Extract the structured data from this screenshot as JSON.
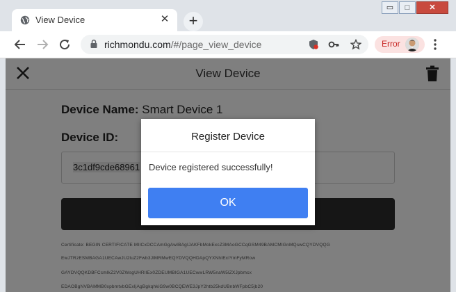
{
  "browser": {
    "tab_title": "View Device",
    "new_tab_label": "+",
    "window_controls": {
      "minimize": "▭",
      "maximize": "□",
      "close": "✕"
    },
    "url_host": "richmondu.com",
    "url_path": "/#/page_view_device",
    "error_label": "Error"
  },
  "page": {
    "title": "View Device",
    "device_name_label": "Device Name:",
    "device_name_value": "Smart Device 1",
    "device_id_label": "Device ID:",
    "device_id_value": "3c1df9cde68961",
    "cert_lines": [
      "Certificate:       BEGIN CERTIFICATE          MIICxDCCAmGgAwIBAgIJAKFbMokExcZ3MAoGCCqGSM49BAMCMIGnMQswCQYDVQQG",
      "EwJTRzESMBAGA1UECAwJU2luZ2Fwb3JlMRMwEQYDVQQHDApQYXNhIExIYmFyMRow",
      "GAYDVQQKDBFCcmlkZ2V0ZWsgUHRlIEx0ZDEUMBIGA1UECwwLRW5naW5lZXJpbmcx",
      "EDAOBgNVBAMMB0xpbmtvbGExIjAgBgkqhkiG9w0BCQEWE3JpY2htb25kdUBnbWFpbC5jb20"
    ]
  },
  "dialog": {
    "title": "Register Device",
    "message": "Device registered successfully!",
    "ok_label": "OK"
  },
  "colors": {
    "ok_button": "#3f7ff2",
    "error_text": "#c5221f",
    "overlay": "rgba(0,0,0,0.5)"
  }
}
